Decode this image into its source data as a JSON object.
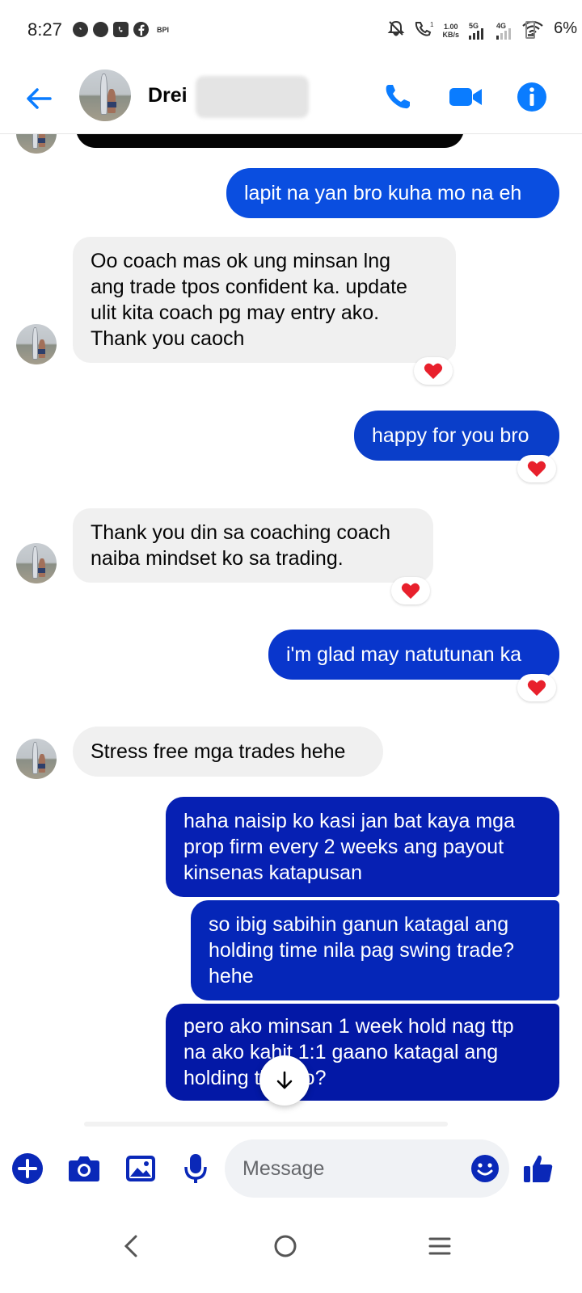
{
  "status_bar": {
    "time": "8:27",
    "left_icons": [
      "messenger-icon",
      "chat-icon",
      "viber-icon",
      "facebook-icon"
    ],
    "bpi_label": "BPI",
    "net_speed": "1.00",
    "net_speed_unit": "KB/s",
    "sig1_label": "5G",
    "sig2_label": "4G",
    "battery": "6%"
  },
  "header": {
    "contact_name": "Drei",
    "colors": {
      "accent": "#0a7cff"
    }
  },
  "messages": [
    {
      "id": 1,
      "sender": "me",
      "text": "lapit na yan bro kuha mo na eh"
    },
    {
      "id": 2,
      "sender": "them",
      "lines": [
        "Oo coach mas ok ung minsan lng",
        "ang trade tpos confident ka. update",
        "ulit kita coach pg may entry ako.",
        "Thank you caoch"
      ],
      "reaction": "heart"
    },
    {
      "id": 3,
      "sender": "me",
      "text": "happy for you bro",
      "reaction": "heart"
    },
    {
      "id": 4,
      "sender": "them",
      "lines": [
        "Thank you din sa coaching coach",
        "naiba mindset ko sa trading."
      ],
      "reaction": "heart"
    },
    {
      "id": 5,
      "sender": "me",
      "text": "i'm glad may natutunan ka",
      "reaction": "heart"
    },
    {
      "id": 6,
      "sender": "them",
      "text": "Stress free mga trades hehe"
    },
    {
      "id": 7,
      "sender": "me",
      "lines": [
        "haha naisip ko kasi jan bat kaya mga",
        "prop firm every 2 weeks ang payout",
        "kinsenas katapusan"
      ]
    },
    {
      "id": 8,
      "sender": "me",
      "lines": [
        "so ibig sabihin ganun katagal ang",
        "holding time nila pag swing trade?",
        "hehe"
      ]
    },
    {
      "id": 9,
      "sender": "me",
      "lines": [
        "pero ako minsan 1 week hold nag ttp",
        "na ako kahit 1:1 gaano katagal ang",
        "holding ti    mo?"
      ]
    }
  ],
  "composer": {
    "placeholder": "Message"
  },
  "colors": {
    "outgoing": "#0844d6",
    "outgoing_dark": "#0318a6",
    "incoming": "#f0f0f0",
    "heart": "#e8202c"
  }
}
